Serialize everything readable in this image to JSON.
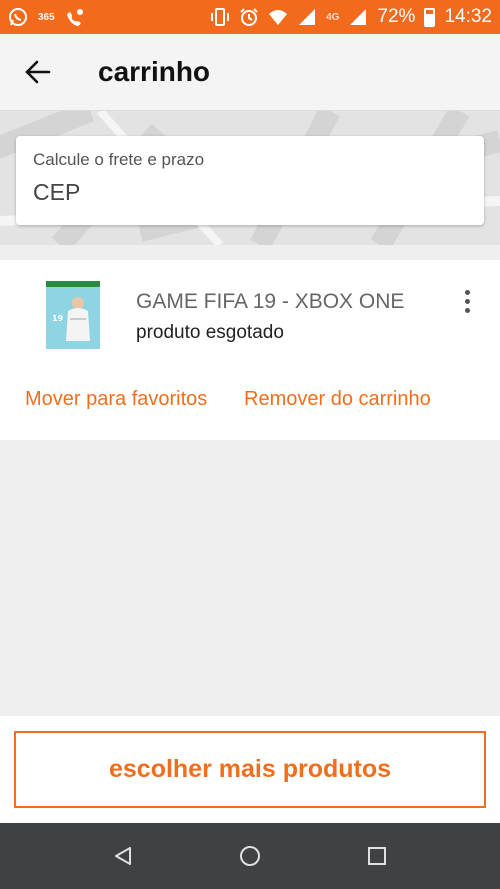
{
  "status_bar": {
    "left_icons": [
      "whatsapp-icon",
      "app-365-icon",
      "missed-call-icon"
    ],
    "app_365_label": "365",
    "network_label": "4G",
    "battery_percent": "72%",
    "time": "14:32",
    "accent_color": "#f26b1d"
  },
  "header": {
    "back_icon": "arrow-left-icon",
    "title": "carrinho"
  },
  "cep": {
    "label": "Calcule o frete e prazo",
    "value": "CEP"
  },
  "cart": {
    "items": [
      {
        "name": "GAME FIFA 19 - XBOX ONE",
        "status": "produto esgotado",
        "menu_icon": "more-vertical-icon",
        "actions": {
          "move_to_favorites": "Mover para favoritos",
          "remove_from_cart": "Remover do carrinho"
        }
      }
    ]
  },
  "footer": {
    "cta_label": "escolher mais produtos"
  },
  "nav": {
    "icons": [
      "back-triangle-icon",
      "home-circle-icon",
      "recents-square-icon"
    ]
  }
}
